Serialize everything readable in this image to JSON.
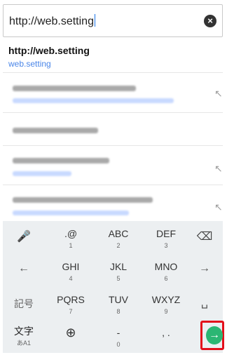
{
  "url_bar": {
    "value": "http://web.setting",
    "clear_icon": "×"
  },
  "suggestion": {
    "title": "http://web.setting",
    "subtitle": "web.setting"
  },
  "keyboard": {
    "left_column": [
      "🎤",
      "←",
      "記号",
      "文字"
    ],
    "left_column_sub": [
      "",
      "",
      "",
      "あA1"
    ],
    "row1": [
      {
        "main": ".@",
        "sub": "1"
      },
      {
        "main": "ABC",
        "sub": "2"
      },
      {
        "main": "DEF",
        "sub": "3"
      }
    ],
    "row2": [
      {
        "main": "GHI",
        "sub": "4"
      },
      {
        "main": "JKL",
        "sub": "5"
      },
      {
        "main": "MNO",
        "sub": "6"
      }
    ],
    "row3": [
      {
        "main": "PQRS",
        "sub": "7"
      },
      {
        "main": "TUV",
        "sub": "8"
      },
      {
        "main": "WXYZ",
        "sub": "9"
      }
    ],
    "row4": [
      {
        "main": "⊕",
        "sub": ""
      },
      {
        "main": "-",
        "sub": "0"
      },
      {
        "main": ", .",
        "sub": ""
      }
    ],
    "right_column": [
      "⌫",
      "→",
      "␣"
    ],
    "go_arrow": "→"
  },
  "colors": {
    "accent": "#2bb673",
    "highlight": "#e3101b",
    "link": "#4a86e8"
  }
}
